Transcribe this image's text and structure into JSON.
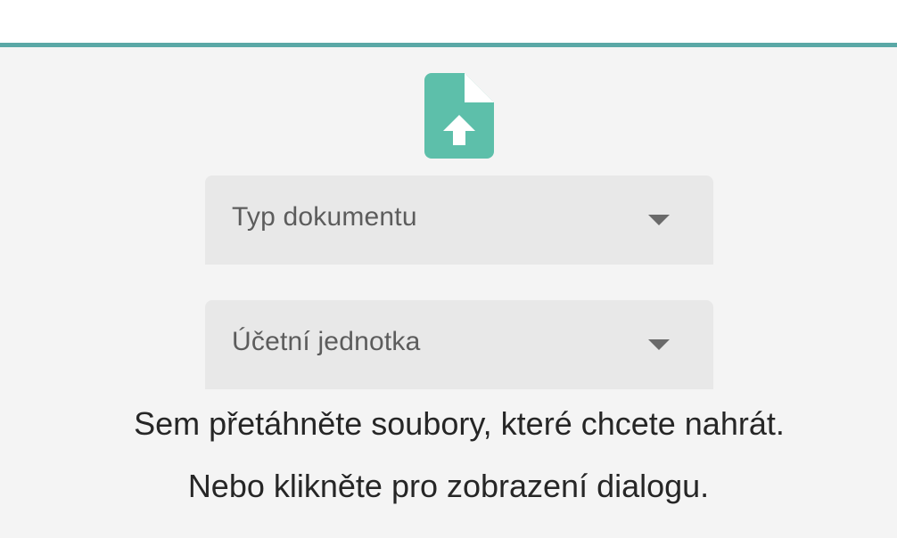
{
  "colors": {
    "accent": "#5aa8a6",
    "icon": "#5dbfaa",
    "background": "#f4f4f4",
    "select_background": "#e8e8e8"
  },
  "upload": {
    "icon": "file-upload-icon"
  },
  "selects": {
    "document_type": {
      "label": "Typ dokumentu",
      "icon": "caret-down-icon"
    },
    "accounting_unit": {
      "label": "Účetní jednotka",
      "icon": "caret-down-icon"
    }
  },
  "dropzone": {
    "instruction": "Sem přetáhněte soubory, které chcete nahrát.",
    "alternative": "Nebo klikněte pro zobrazení dialogu."
  }
}
